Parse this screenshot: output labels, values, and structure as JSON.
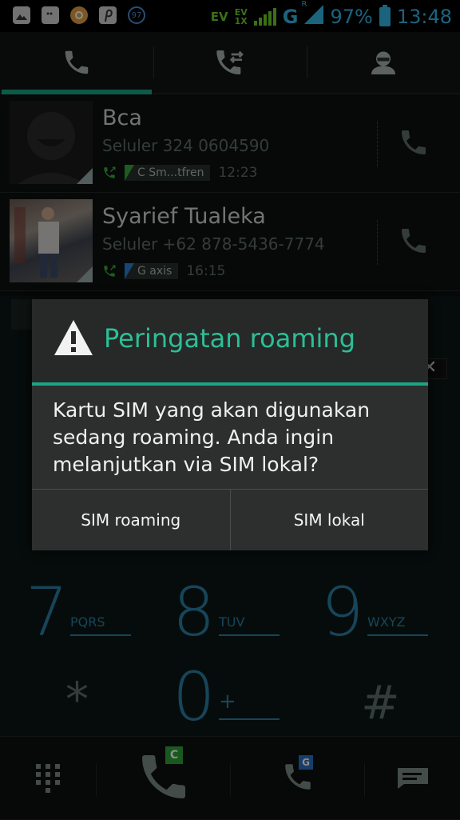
{
  "status_bar": {
    "notif_icons": [
      "gallery-icon",
      "bbm-icon",
      "orange-app-icon",
      "pinterest-icon",
      "badge-icon"
    ],
    "badge_count": "97",
    "network_ev": "EV",
    "network_ev_1x_top": "EV",
    "network_ev_1x_bottom": "1X",
    "network_g": "G",
    "network_r": "R",
    "battery": "97%",
    "time": "13:48"
  },
  "tabs": [
    {
      "name": "phone",
      "active": true
    },
    {
      "name": "call-log",
      "active": false
    },
    {
      "name": "contacts",
      "active": false
    }
  ],
  "call_log": [
    {
      "name": "Bca",
      "number": "Seluler 324 0604590",
      "sim": "C Sm...tfren",
      "time": "12:23"
    },
    {
      "name": "Syarief Tualeka",
      "number": "Seluler +62 878-5436-7774",
      "sim": "G axis",
      "time": "16:15"
    }
  ],
  "dialpad": {
    "keys": [
      {
        "digit": "7",
        "letters": "PQRS"
      },
      {
        "digit": "8",
        "letters": "TUV"
      },
      {
        "digit": "9",
        "letters": "WXYZ"
      },
      {
        "digit": "*",
        "letters": ""
      },
      {
        "digit": "0",
        "letters": "+"
      },
      {
        "digit": "#",
        "letters": ""
      }
    ],
    "delete_label": "✕"
  },
  "bottom_bar": {
    "sim_c_label": "C",
    "sim_g_label": "G",
    "sim_c_color": "#2fa33a",
    "sim_g_color": "#2a6fc4"
  },
  "dialog": {
    "title": "Peringatan roaming",
    "message": "Kartu SIM yang akan digunakan sedang roaming. Anda ingin melanjutkan via SIM lokal?",
    "button_left": "SIM roaming",
    "button_right": "SIM lokal"
  },
  "colors": {
    "accent": "#1aa586",
    "title": "#2dbf96",
    "status_blue": "#33b5e5",
    "status_green": "#6bcc2a"
  }
}
